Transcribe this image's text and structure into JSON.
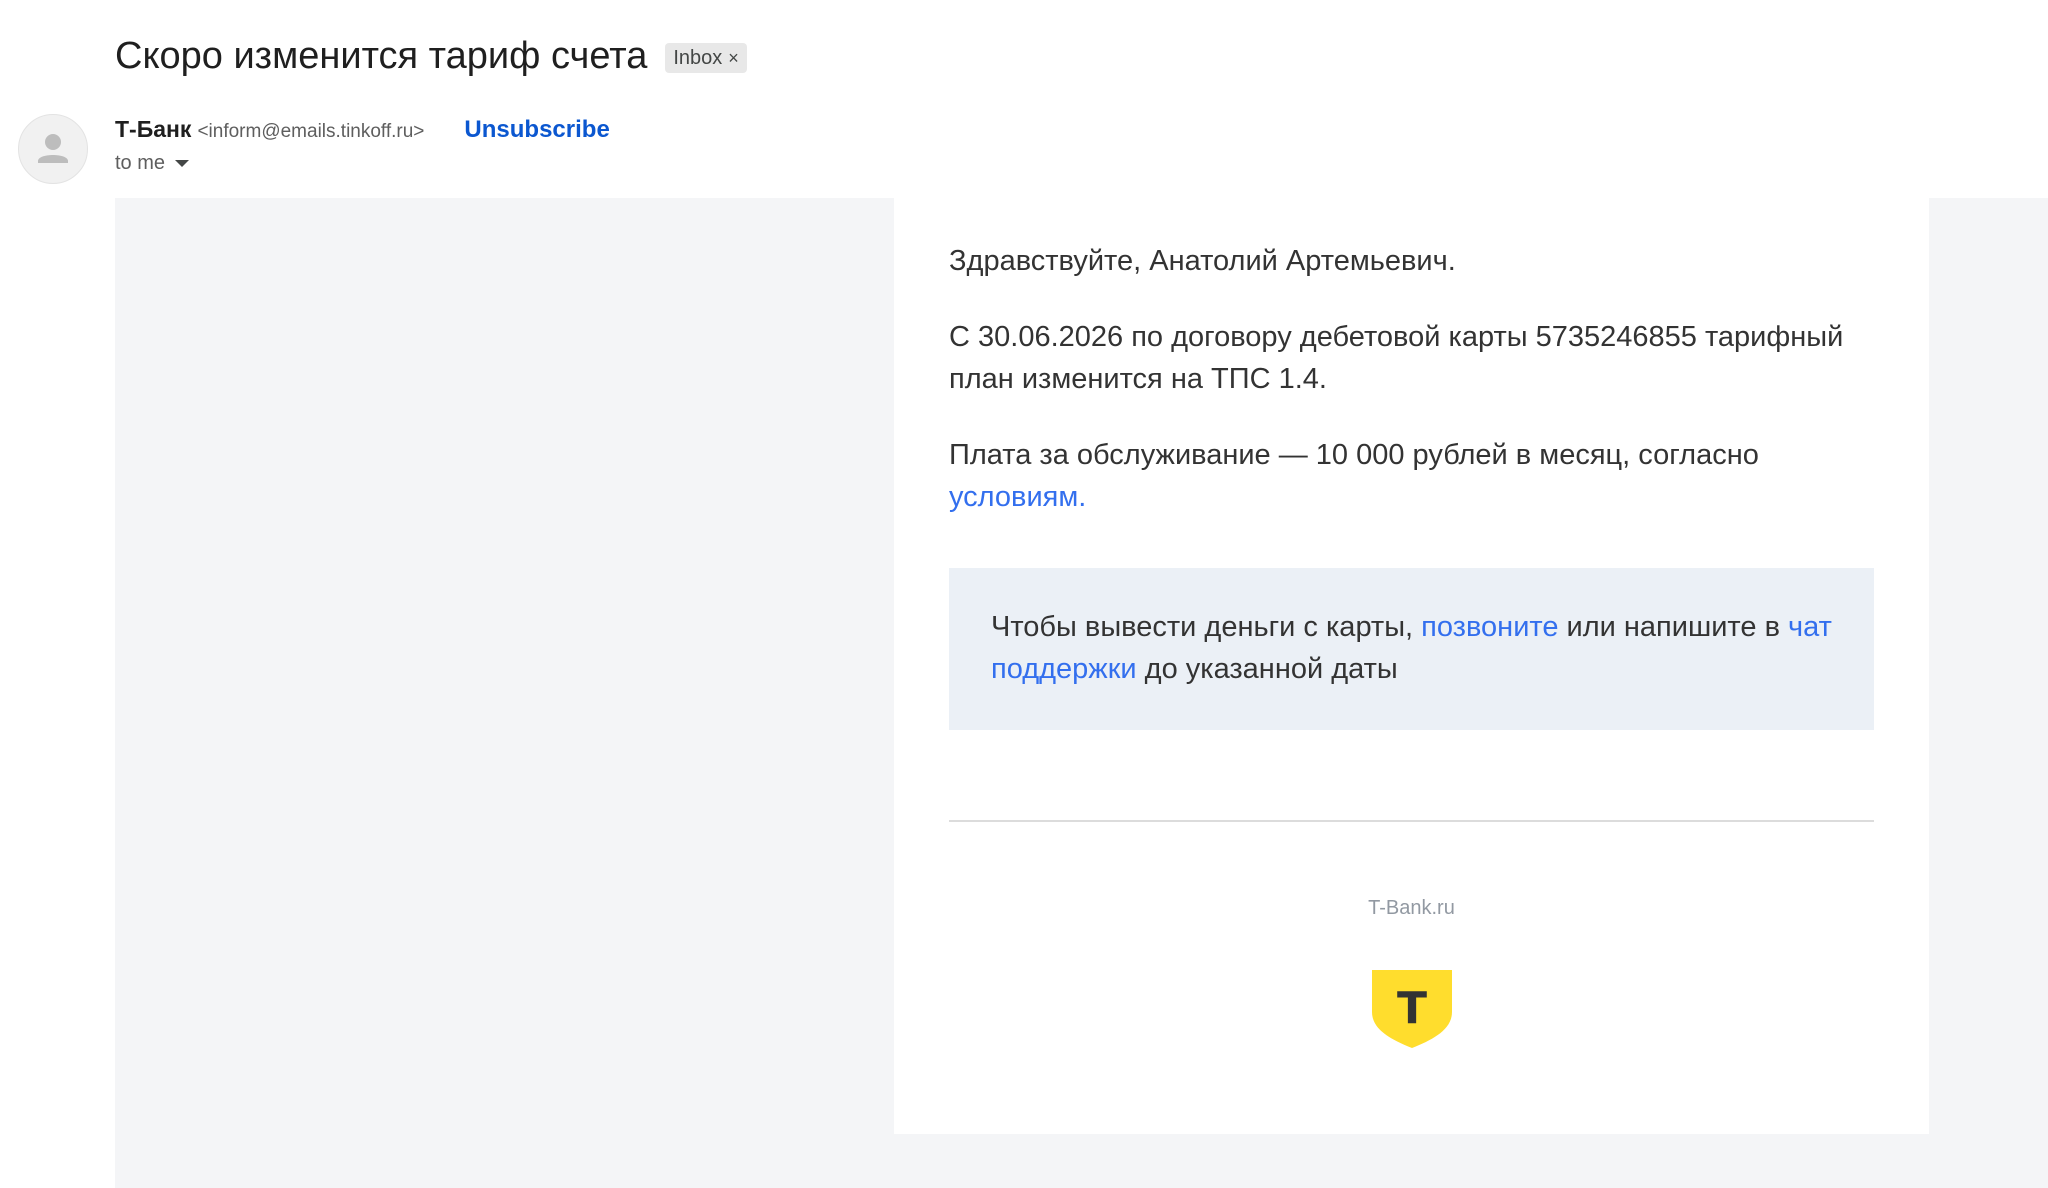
{
  "email": {
    "subject": "Скоро изменится тариф счета",
    "label": "Inbox",
    "label_remove": "×",
    "sender": {
      "name": "Т-Банк",
      "email": "<inform@emails.tinkoff.ru>"
    },
    "unsubscribe_label": "Unsubscribe",
    "recipient": "to me"
  },
  "body": {
    "greeting": "Здравствуйте, Анатолий Артемьевич.",
    "tariff_change": "С 30.06.2026 по договору дебетовой карты 5735246855 тарифный план изменится на ТПС 1.4.",
    "fee_text": "Плата за обслуживание — 10 000 рублей в месяц, согласно ",
    "fee_link": "условиям.",
    "info_part1": "Чтобы вывести деньги с карты, ",
    "info_link_call": "позвоните",
    "info_part2": " или напишите в ",
    "info_link_chat": "чат поддержки",
    "info_part3": " до указанной даты",
    "footer_site": "T-Bank.ru",
    "logo_letter": "Т"
  },
  "colors": {
    "link": "#336fee",
    "gmail_link": "#0b57d0",
    "info_box_bg": "#ebf0f6",
    "logo_yellow": "#ffdd2d",
    "logo_letter": "#333333"
  }
}
